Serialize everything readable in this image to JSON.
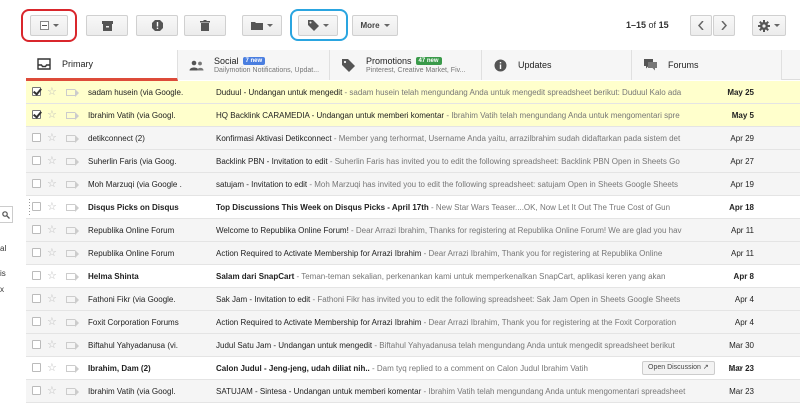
{
  "toolbar": {
    "more_label": "More",
    "pagination": {
      "range": "1–15",
      "of": "of",
      "total": "15"
    },
    "highlight_colors": {
      "select": "#d9262c",
      "labels": "#2aa5e0"
    }
  },
  "left_edge": {
    "fragments": [
      "al",
      "is",
      "x"
    ]
  },
  "tabs": [
    {
      "id": "primary",
      "title": "Primary",
      "subtitle": "",
      "badge": "",
      "icon": "inbox-icon"
    },
    {
      "id": "social",
      "title": "Social",
      "subtitle": "Dailymotion Notifications, Updat...",
      "badge": "7 new",
      "badge_color": "#4a7ee0",
      "icon": "people-icon"
    },
    {
      "id": "promotions",
      "title": "Promotions",
      "subtitle": "Pinterest, Creative Market, Fiv...",
      "badge": "47 new",
      "badge_color": "#3a9a4a",
      "icon": "tag-icon"
    },
    {
      "id": "updates",
      "title": "Updates",
      "subtitle": "",
      "badge": "",
      "icon": "info-icon"
    },
    {
      "id": "forums",
      "title": "Forums",
      "subtitle": "",
      "badge": "",
      "icon": "forum-icon"
    }
  ],
  "messages": [
    {
      "sender": "sadam husein (via Google.",
      "subject": "Duduul - Undangan untuk mengedit",
      "snippet": " - sadam husein telah mengundang Anda untuk mengedit spreadsheet berikut: Duduul Kalo ada",
      "date": "May 25",
      "state": "selected",
      "checked": true
    },
    {
      "sender": "Ibrahim Vatih (via Googl.",
      "subject": "HQ Backlink CARAMEDIA - Undangan untuk memberi komentar",
      "snippet": " - Ibrahim Vatih telah mengundang Anda untuk mengomentari spre",
      "date": "May 5",
      "state": "selected",
      "checked": true
    },
    {
      "sender": "detikconnect (2)",
      "subject": "Konfirmasi Aktivasi Detikconnect",
      "snippet": " - Member yang terhormat, Username Anda yaitu, arrazilbrahim sudah didaftarkan pada sistem det",
      "date": "Apr 29",
      "state": "read",
      "checked": false
    },
    {
      "sender": "Suherlin Faris (via Goog.",
      "subject": "Backlink PBN - Invitation to edit",
      "snippet": " - Suherlin Faris has invited you to edit the following spreadsheet: Backlink PBN Open in Sheets Go",
      "date": "Apr 27",
      "state": "read",
      "checked": false
    },
    {
      "sender": "Moh Marzuqi (via Google .",
      "subject": "satujam - Invitation to edit",
      "snippet": " - Moh Marzuqi has invited you to edit the following spreadsheet: satujam Open in Sheets Google Sheets",
      "date": "Apr 19",
      "state": "read",
      "checked": false
    },
    {
      "sender": "Disqus Picks on Disqus",
      "subject": "Top Discussions This Week on Disqus Picks - April 17th",
      "snippet": " - New Star Wars Teaser....OK, Now Let It Out The True Cost of Gun",
      "date": "Apr 18",
      "state": "unread",
      "checked": false
    },
    {
      "sender": "Republika Online Forum",
      "subject": "Welcome to Republika Online Forum!",
      "snippet": " - Dear Arrazi Ibrahim, Thanks for registering at Republika Online Forum! We are glad you hav",
      "date": "Apr 11",
      "state": "read",
      "checked": false
    },
    {
      "sender": "Republika Online Forum",
      "subject": "Action Required to Activate Membership for Arrazi Ibrahim",
      "snippet": " - Dear Arrazi Ibrahim, Thank you for registering at Republika Online",
      "date": "Apr 11",
      "state": "read",
      "checked": false
    },
    {
      "sender": "Helma Shinta",
      "subject": "Salam dari SnapCart",
      "snippet": " - Teman-teman sekalian, perkenankan kami untuk memperkenalkan SnapCart, aplikasi keren yang akan",
      "date": "Apr 8",
      "state": "unread",
      "checked": false
    },
    {
      "sender": "Fathoni Fikr (via Google.",
      "subject": "Sak Jam - Invitation to edit",
      "snippet": " - Fathoni Fikr has invited you to edit the following spreadsheet: Sak Jam Open in Sheets Google Sheets",
      "date": "Apr 4",
      "state": "read",
      "checked": false
    },
    {
      "sender": "Foxit Corporation Forums",
      "subject": "Action Required to Activate Membership for Arrazi Ibrahim",
      "snippet": " - Dear Arrazi Ibrahim, Thank you for registering at the Foxit Corporation",
      "date": "Apr 4",
      "state": "read",
      "checked": false
    },
    {
      "sender": "Biftahul Yahyadanusa (vi.",
      "subject": "Judul Satu Jam - Undangan untuk mengedit",
      "snippet": " - Biftahul Yahyadanusa telah mengundang Anda untuk mengedit spreadsheet berikut",
      "date": "Mar 30",
      "state": "read",
      "checked": false
    },
    {
      "sender": "Ibrahim, Dam (2)",
      "subject": "Calon Judul - Jeng-jeng, udah diliat nih..",
      "snippet": " - Dam tyq replied to a comment on Calon Judul Ibrahim Vatih",
      "date": "Mar 23",
      "state": "unread",
      "checked": false,
      "chip": "Open Discussion ↗",
      "attachment": true
    },
    {
      "sender": "Ibrahim Vatih (via Googl.",
      "subject": "SATUJAM - Sintesa - Undangan untuk memberi komentar",
      "snippet": " - Ibrahim Vatih telah mengundang Anda untuk mengomentari spreadsheet",
      "date": "Mar 23",
      "state": "read",
      "checked": false
    }
  ]
}
